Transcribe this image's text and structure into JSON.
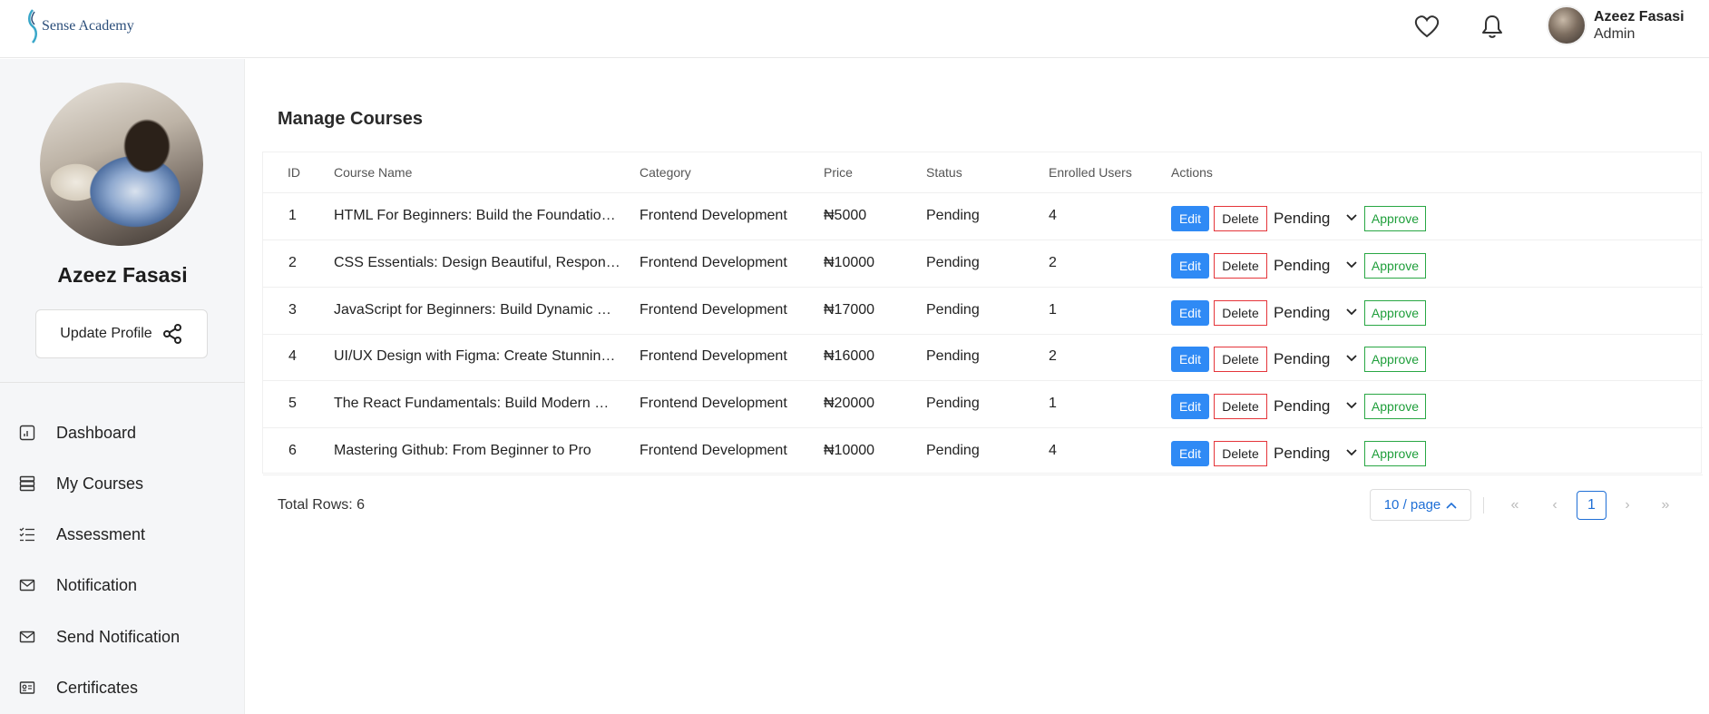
{
  "header": {
    "logo_text": "Sense Academy",
    "icons": [
      "heart-icon",
      "bell-icon"
    ],
    "user": {
      "name": "Azeez Fasasi",
      "role": "Admin"
    }
  },
  "sidebar": {
    "profile_name": "Azeez Fasasi",
    "update_profile_label": "Update Profile",
    "items": [
      {
        "label": "Dashboard",
        "icon": "dashboard-icon"
      },
      {
        "label": "My Courses",
        "icon": "courses-icon"
      },
      {
        "label": "Assessment",
        "icon": "assessment-icon"
      },
      {
        "label": "Notification",
        "icon": "mail-icon"
      },
      {
        "label": "Send Notification",
        "icon": "mail-icon"
      },
      {
        "label": "Certificates",
        "icon": "certificate-icon"
      }
    ]
  },
  "main": {
    "title": "Manage Courses",
    "columns": [
      "ID",
      "Course Name",
      "Category",
      "Price",
      "Status",
      "Enrolled Users",
      "Actions"
    ],
    "rows": [
      {
        "id": "1",
        "name": "HTML For Beginners: Build the Foundation of Web Development",
        "category": "Frontend Development",
        "price": "₦5000",
        "status": "Pending",
        "enrolled": "4",
        "select_value": "Pending"
      },
      {
        "id": "2",
        "name": "CSS Essentials: Design Beautiful, Responsive Websites",
        "category": "Frontend Development",
        "price": "₦10000",
        "status": "Pending",
        "enrolled": "2",
        "select_value": "Pending"
      },
      {
        "id": "3",
        "name": "JavaScript for Beginners: Build Dynamic Web Pages",
        "category": "Frontend Development",
        "price": "₦17000",
        "status": "Pending",
        "enrolled": "1",
        "select_value": "Pending"
      },
      {
        "id": "4",
        "name": "UI/UX Design with Figma: Create Stunning Interfaces",
        "category": "Frontend Development",
        "price": "₦16000",
        "status": "Pending",
        "enrolled": "2",
        "select_value": "Pending"
      },
      {
        "id": "5",
        "name": "The React Fundamentals: Build Modern Web Apps",
        "category": "Frontend Development",
        "price": "₦20000",
        "status": "Pending",
        "enrolled": "1",
        "select_value": "Pending"
      },
      {
        "id": "6",
        "name": "Mastering Github: From Beginner to Pro",
        "category": "Frontend Development",
        "price": "₦10000",
        "status": "Pending",
        "enrolled": "4",
        "select_value": "Pending"
      }
    ],
    "actions": {
      "edit": "Edit",
      "delete": "Delete",
      "approve": "Approve"
    },
    "footer": {
      "total_rows": "Total Rows: 6",
      "page_size": "10 / page",
      "current_page": "1"
    }
  },
  "colors": {
    "primary": "#2f8af5",
    "danger": "#e5353a",
    "success": "#29a744",
    "link": "#1f6fd6"
  }
}
